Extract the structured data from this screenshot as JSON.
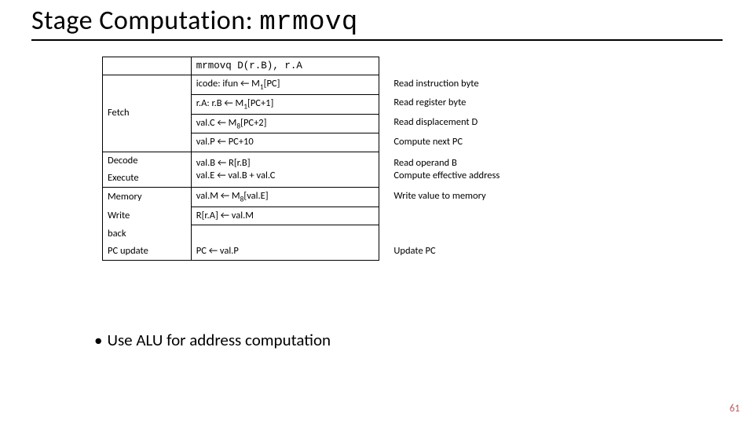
{
  "title_prefix": "Stage Computation: ",
  "title_mono": "mrmovq",
  "header_op": "mrmovq D(r.B), r.A",
  "rows": [
    {
      "stage": "Fetch",
      "ops": [
        {
          "text": "icode: ifun ← M",
          "sub": "1",
          "tail": "[PC]",
          "desc": "Read instruction byte"
        },
        {
          "text": "r.A: r.B ← M",
          "sub": "1",
          "tail": "[PC+1]",
          "desc": "Read register byte"
        },
        {
          "text": "val.C ← M",
          "sub": "8",
          "tail": "[PC+2]",
          "desc": "Read displacement D"
        },
        {
          "text": "val.P ← PC+10",
          "sub": "",
          "tail": "",
          "desc": "Compute next PC"
        }
      ]
    },
    {
      "stage": "Decode",
      "ops": [
        {
          "text": "val.B ← R[r.B]",
          "sub": "",
          "tail": "",
          "desc": "Read operand B"
        }
      ]
    },
    {
      "stage": "Execute",
      "ops": [
        {
          "text": "val.E ← val.B + val.C",
          "sub": "",
          "tail": "",
          "desc": "Compute effective address"
        }
      ]
    },
    {
      "stage": "Memory",
      "ops": [
        {
          "text": "val.M ←  M",
          "sub": "8",
          "tail": "[val.E]",
          "desc": "Write value to memory"
        }
      ]
    },
    {
      "stage": "Write",
      "ops": [
        {
          "text": "R[r.A] ← val.M",
          "sub": "",
          "tail": "",
          "desc": ""
        }
      ]
    },
    {
      "stage": "back",
      "ops": []
    },
    {
      "stage": "PC update",
      "ops": [
        {
          "text": "PC ← val.P",
          "sub": "",
          "tail": "",
          "desc": "Update PC"
        }
      ]
    }
  ],
  "bullet_text": "Use ALU for address computation",
  "page_number": "61"
}
